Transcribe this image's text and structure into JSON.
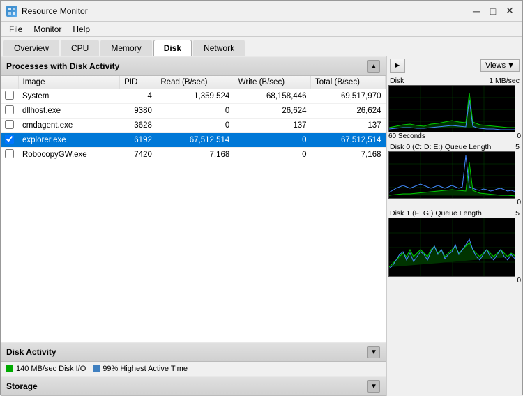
{
  "titleBar": {
    "title": "Resource Monitor",
    "minimizeLabel": "─",
    "maximizeLabel": "□",
    "closeLabel": "✕"
  },
  "menuBar": {
    "items": [
      "File",
      "Monitor",
      "Help"
    ]
  },
  "tabs": [
    {
      "label": "Overview",
      "active": false
    },
    {
      "label": "CPU",
      "active": false
    },
    {
      "label": "Memory",
      "active": false
    },
    {
      "label": "Disk",
      "active": true
    },
    {
      "label": "Network",
      "active": false
    }
  ],
  "processesSection": {
    "title": "Processes with Disk Activity",
    "columns": [
      "Image",
      "PID",
      "Read (B/sec)",
      "Write (B/sec)",
      "Total (B/sec)"
    ],
    "rows": [
      {
        "checked": false,
        "image": "System",
        "pid": "4",
        "read": "1,359,524",
        "write": "68,158,446",
        "total": "69,517,970",
        "selected": false
      },
      {
        "checked": false,
        "image": "dllhost.exe",
        "pid": "9380",
        "read": "0",
        "write": "26,624",
        "total": "26,624",
        "selected": false
      },
      {
        "checked": false,
        "image": "cmdagent.exe",
        "pid": "3628",
        "read": "0",
        "write": "137",
        "total": "137",
        "selected": false
      },
      {
        "checked": true,
        "image": "explorer.exe",
        "pid": "6192",
        "read": "67,512,514",
        "write": "0",
        "total": "67,512,514",
        "selected": true
      },
      {
        "checked": false,
        "image": "RobocopyGW.exe",
        "pid": "7420",
        "read": "7,168",
        "write": "0",
        "total": "7,168",
        "selected": false
      }
    ]
  },
  "diskActivitySection": {
    "title": "Disk Activity",
    "stat1": "140 MB/sec Disk I/O",
    "stat2": "99% Highest Active Time"
  },
  "storageSection": {
    "title": "Storage"
  },
  "rightPanel": {
    "viewsLabel": "Views",
    "charts": [
      {
        "label": "Disk",
        "topScale": "1 MB/sec",
        "bottomLeft": "60 Seconds",
        "bottomRight": "0"
      },
      {
        "label": "Disk 0 (C: D: E:) Queue Length",
        "topScale": "5",
        "bottomLeft": "",
        "bottomRight": "0"
      },
      {
        "label": "Disk 1 (F: G:) Queue Length",
        "topScale": "5",
        "bottomLeft": "",
        "bottomRight": "0"
      }
    ]
  }
}
